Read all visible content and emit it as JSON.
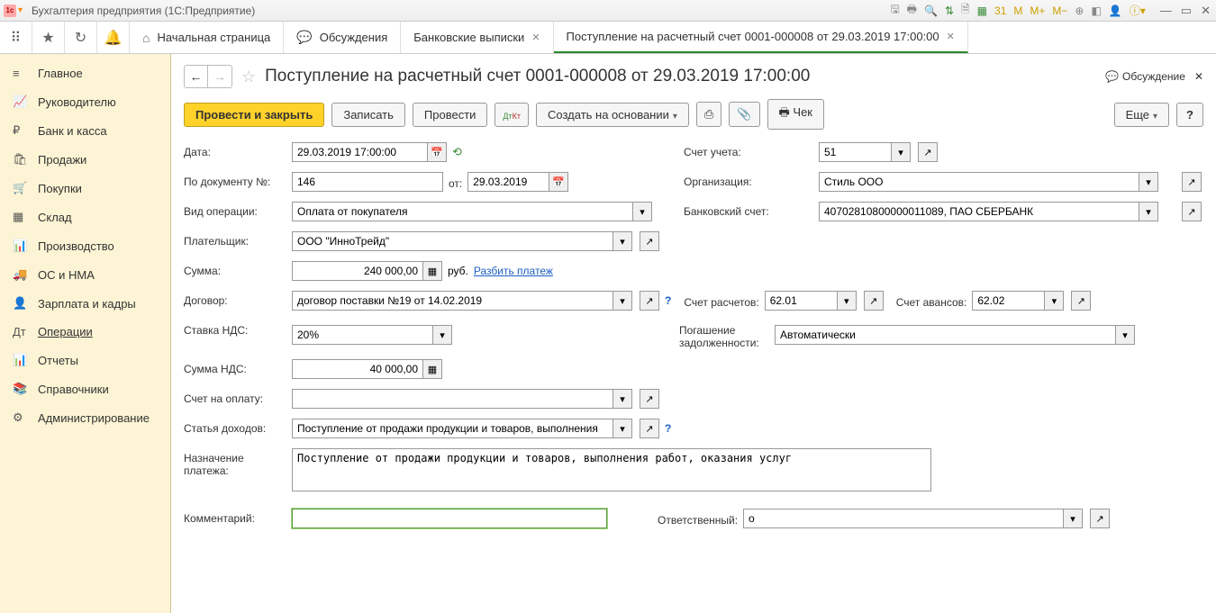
{
  "titlebar": {
    "title": "Бухгалтерия предприятия  (1С:Предприятие)"
  },
  "tabs": {
    "home": "Начальная страница",
    "discuss": "Обсуждения",
    "bank": "Банковские выписки",
    "current": "Поступление на расчетный счет 0001-000008 от 29.03.2019 17:00:00"
  },
  "sidebar": {
    "items": [
      {
        "icon": "≡",
        "label": "Главное"
      },
      {
        "icon": "📈",
        "label": "Руководителю"
      },
      {
        "icon": "₽",
        "label": "Банк и касса"
      },
      {
        "icon": "🛍",
        "label": "Продажи"
      },
      {
        "icon": "🛒",
        "label": "Покупки"
      },
      {
        "icon": "▦",
        "label": "Склад"
      },
      {
        "icon": "📊",
        "label": "Производство"
      },
      {
        "icon": "🚚",
        "label": "ОС и НМА"
      },
      {
        "icon": "👤",
        "label": "Зарплата и кадры"
      },
      {
        "icon": "Дт",
        "label": "Операции"
      },
      {
        "icon": "📊",
        "label": "Отчеты"
      },
      {
        "icon": "📚",
        "label": "Справочники"
      },
      {
        "icon": "⚙",
        "label": "Администрирование"
      }
    ]
  },
  "page": {
    "title": "Поступление на расчетный счет 0001-000008 от 29.03.2019 17:00:00",
    "discuss": "Обсуждение"
  },
  "actions": {
    "primary": "Провести и закрыть",
    "save": "Записать",
    "post": "Провести",
    "dtkt": "Дт Кт",
    "createbase": "Создать на основании",
    "check": "Чек",
    "more": "Еще",
    "help": "?"
  },
  "form": {
    "date_lbl": "Дата:",
    "date_val": "29.03.2019 17:00:00",
    "acct_lbl": "Счет учета:",
    "acct_val": "51",
    "docnum_lbl": "По документу №:",
    "docnum_val": "146",
    "from_lbl": "от:",
    "docdate_val": "29.03.2019",
    "org_lbl": "Организация:",
    "org_val": "Стиль ООО",
    "optype_lbl": "Вид операции:",
    "optype_val": "Оплата от покупателя",
    "bankacc_lbl": "Банковский счет:",
    "bankacc_val": "40702810800000011089, ПАО СБЕРБАНК",
    "payer_lbl": "Плательщик:",
    "payer_val": "ООО \"ИнноТрейд\"",
    "sum_lbl": "Сумма:",
    "sum_val": "240 000,00",
    "currency": "руб.",
    "split": "Разбить платеж",
    "contract_lbl": "Договор:",
    "contract_val": "договор поставки №19 от 14.02.2019",
    "calcacct_lbl": "Счет расчетов:",
    "calcacct_val": "62.01",
    "advacct_lbl": "Счет авансов:",
    "advacct_val": "62.02",
    "vatrate_lbl": "Ставка НДС:",
    "vatrate_val": "20%",
    "debt_lbl": "Погашение задолженности:",
    "debt_val": "Автоматически",
    "vatsum_lbl": "Сумма НДС:",
    "vatsum_val": "40 000,00",
    "invoice_lbl": "Счет на оплату:",
    "invoice_val": "",
    "income_lbl": "Статья доходов:",
    "income_val": "Поступление от продажи продукции и товаров, выполнения",
    "purpose_lbl": "Назначение платежа:",
    "purpose_val": "Поступление от продажи продукции и товаров, выполнения работ, оказания услуг",
    "comment_lbl": "Комментарий:",
    "comment_val": "",
    "resp_lbl": "Ответственный:",
    "resp_val": "о"
  }
}
